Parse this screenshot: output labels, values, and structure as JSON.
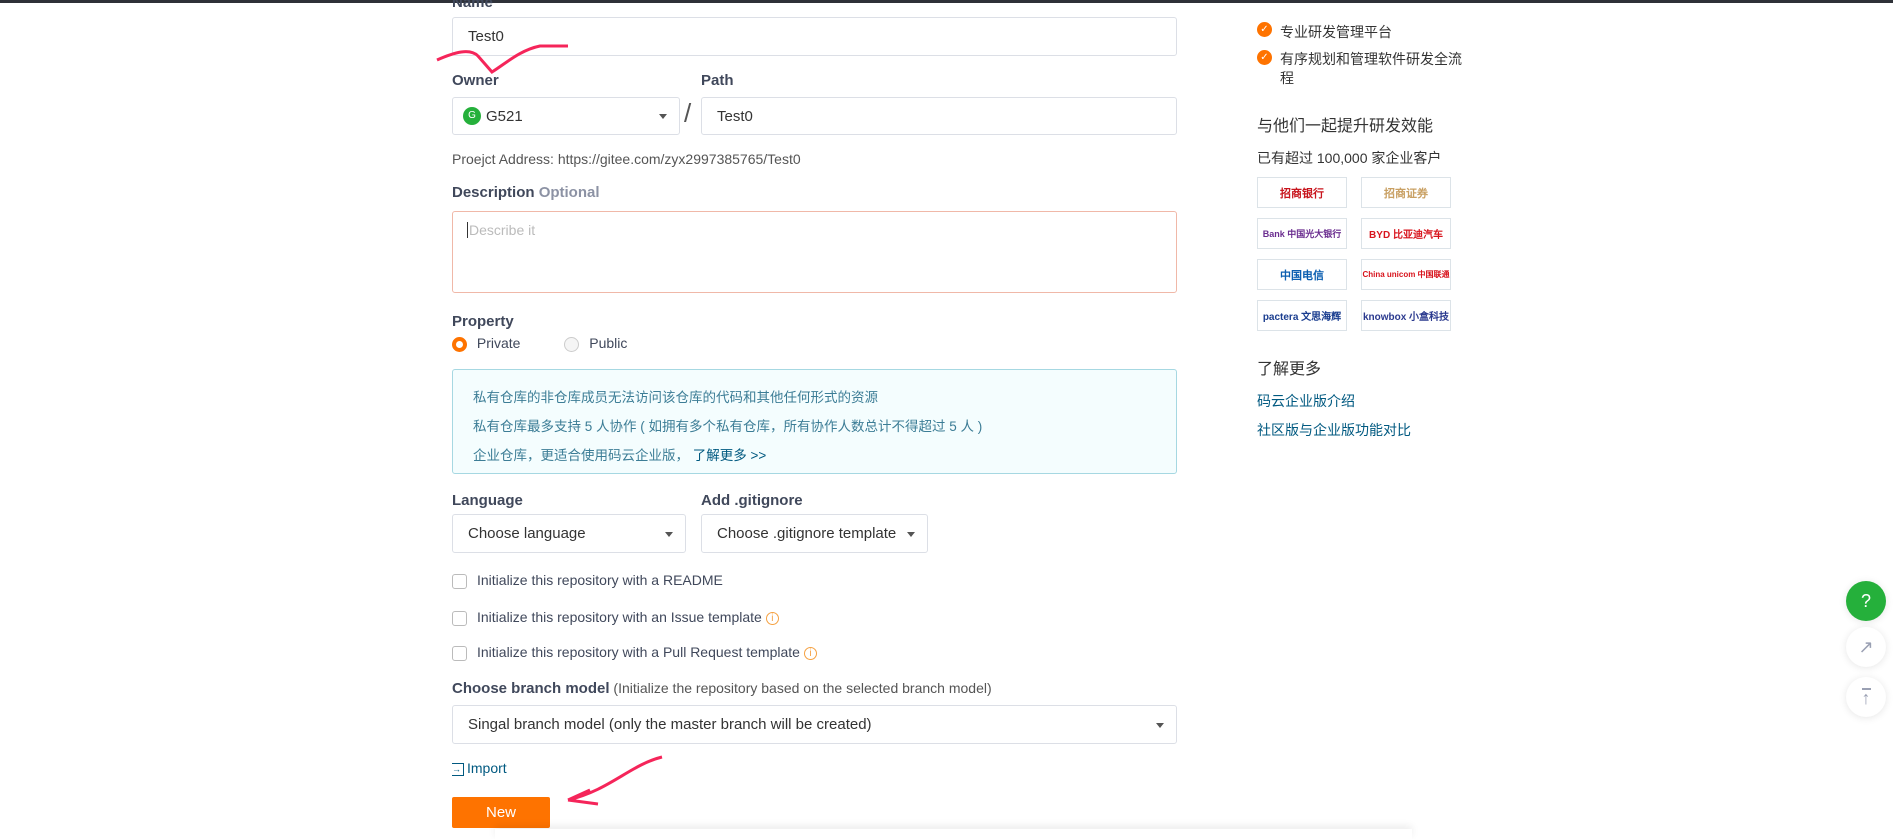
{
  "form": {
    "name_label": "Name",
    "name_value": "Test0",
    "owner_label": "Owner",
    "owner_avatar": "G",
    "owner_value": "G521",
    "path_label": "Path",
    "path_separator": "/",
    "path_value": "Test0",
    "project_address": "Proejct Address: https://gitee.com/zyx2997385765/Test0",
    "description_label": "Description",
    "description_optional": "Optional",
    "description_placeholder": "Describe it",
    "property_label": "Property",
    "private_label": "Private",
    "public_label": "Public",
    "selected_property": "Private",
    "notice_lines": [
      "私有仓库的非仓库成员无法访问该仓库的代码和其他任何形式的资源",
      "私有仓库最多支持 5 人协作 ( 如拥有多个私有仓库，所有协作人数总计不得超过 5 人 )",
      "企业仓库，更适合使用码云企业版，"
    ],
    "notice_link": "了解更多 >>",
    "language_label": "Language",
    "language_value": "Choose language",
    "gitignore_label": "Add .gitignore",
    "gitignore_value": "Choose .gitignore template",
    "checkboxes": [
      {
        "label": "Initialize this repository with a README",
        "checked": false
      },
      {
        "label": "Initialize this repository with an Issue template",
        "checked": false
      },
      {
        "label": "Initialize this repository with a Pull Request template",
        "checked": false
      }
    ],
    "info_icon": "i",
    "branch_label": "Choose branch model",
    "branch_hint": "(Initialize the repository based on the selected branch model)",
    "branch_value": "Singal branch model (only the master branch will be created)",
    "import_label": "Import",
    "new_button": "New"
  },
  "sidebar": {
    "features": [
      "专业研发管理平台",
      "有序规划和管理软件研发全流程"
    ],
    "customers_title": "与他们一起提升研发效能",
    "customers_sub": "已有超过 100,000 家企业客户",
    "logos": [
      "招商银行",
      "招商证券",
      "Bank 中国光大银行",
      "BYD 比亚迪汽车",
      "中国电信",
      "China unicom 中国联通",
      "pactera 文思海辉",
      "knowbox 小盒科技"
    ],
    "more_title": "了解更多",
    "links": [
      "码云企业版介绍",
      "社区版与企业版功能对比"
    ]
  },
  "floating": {
    "help": "?"
  },
  "colors": {
    "accent": "#fe7300",
    "help": "#25b03b",
    "link": "#005980",
    "notice_bg": "#f4fdfe"
  }
}
